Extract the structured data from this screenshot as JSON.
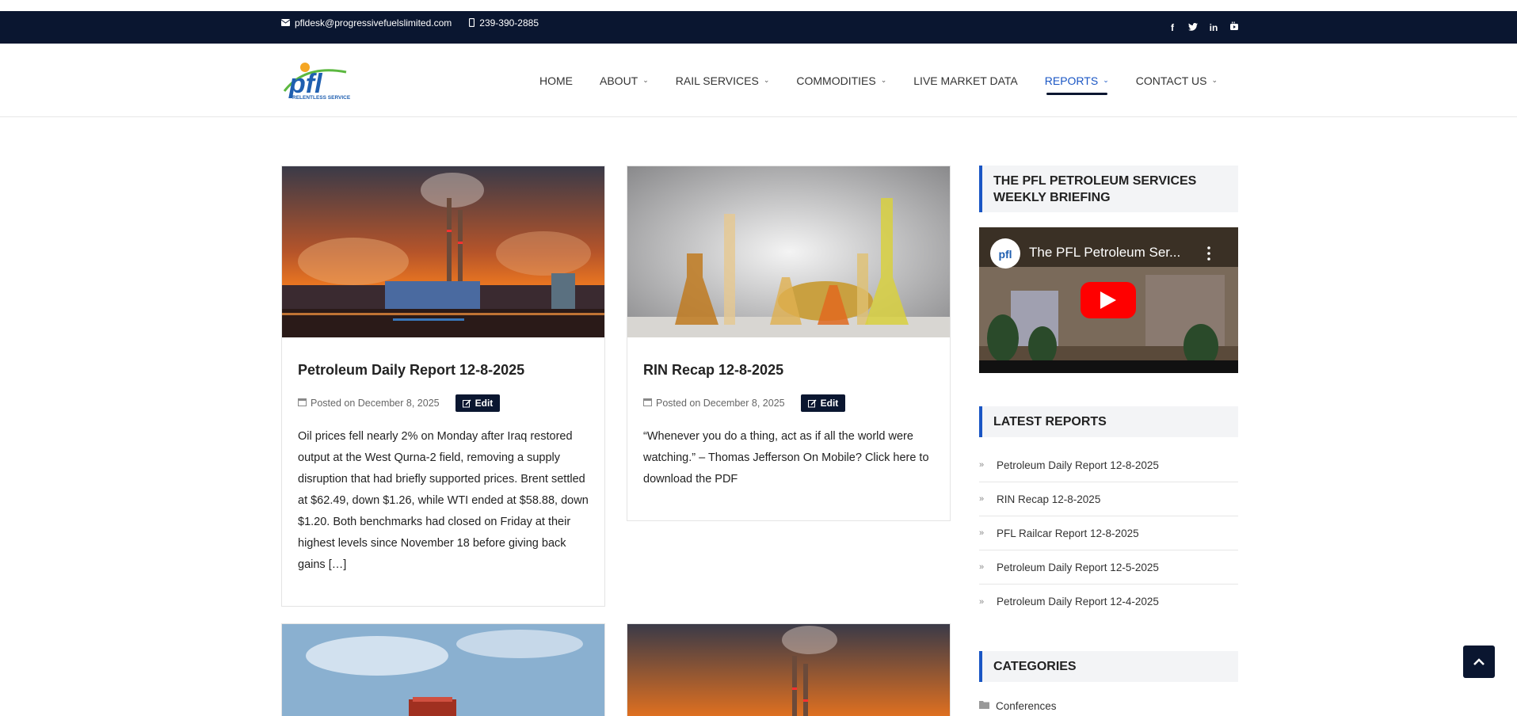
{
  "topbar": {
    "email": "pfldesk@progressivefuelslimited.com",
    "phone": "239-390-2885",
    "social": [
      {
        "icon": "facebook-icon",
        "glyph": "f"
      },
      {
        "icon": "twitter-icon",
        "glyph": "t"
      },
      {
        "icon": "linkedin-icon",
        "glyph": "in"
      },
      {
        "icon": "youtube-icon",
        "glyph": "▶"
      }
    ]
  },
  "logo": {
    "text": "pfl",
    "tagline": "RELENTLESS SERVICE"
  },
  "nav": {
    "home": "HOME",
    "about": "ABOUT",
    "rail_services": "RAIL SERVICES",
    "commodities": "COMMODITIES",
    "live_market_data": "LIVE MARKET DATA",
    "reports": "REPORTS",
    "contact_us": "CONTACT US"
  },
  "posts": [
    {
      "title": "Petroleum Daily Report 12-8-2025",
      "posted": "Posted on December 8, 2025",
      "edit": "Edit",
      "excerpt": "Oil prices fell nearly 2% on Monday after Iraq restored output at the West Qurna-2 field, removing a supply disruption that had briefly supported prices. Brent settled at $62.49, down $1.26, while WTI ended at $58.88, down $1.20. Both benchmarks had closed on Friday at their highest levels since November 18 before giving back gains […]"
    },
    {
      "title": "RIN Recap 12-8-2025",
      "posted": "Posted on December 8, 2025",
      "edit": "Edit",
      "excerpt": "“Whenever you do a thing, act as if all the world were watching.” – Thomas Jefferson On Mobile? Click here to download the PDF"
    }
  ],
  "sidebar": {
    "briefing_title": "THE PFL PETROLEUM SERVICES WEEKLY BRIEFING",
    "video_title": "The PFL Petroleum Ser...",
    "latest_title": "LATEST REPORTS",
    "latest": [
      "Petroleum Daily Report 12-8-2025",
      "RIN Recap 12-8-2025",
      "PFL Railcar Report 12-8-2025",
      "Petroleum Daily Report 12-5-2025",
      "Petroleum Daily Report 12-4-2025"
    ],
    "categories_title": "CATEGORIES",
    "first_category": "Conferences"
  },
  "colors": {
    "navy": "#0a1630",
    "accent": "#1a56c4",
    "youtube_red": "#ff0000"
  }
}
